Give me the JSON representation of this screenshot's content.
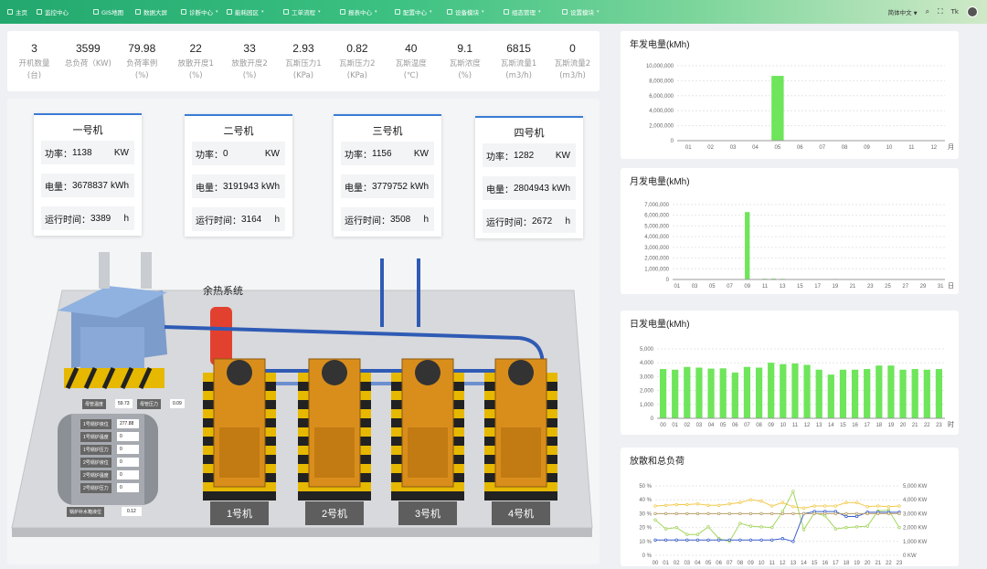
{
  "nav": {
    "items": [
      {
        "label": "主页",
        "icon": "grid-icon"
      },
      {
        "label": "监控中心",
        "icon": "monitor-icon"
      },
      {
        "label": "GIS地图",
        "icon": "map-icon"
      },
      {
        "label": "数据大屏",
        "icon": "screen-icon"
      },
      {
        "label": "诊断中心",
        "icon": "diagnose-icon"
      },
      {
        "label": "能耗园区",
        "icon": "energy-icon"
      },
      {
        "label": "工单流程",
        "icon": "workflow-icon"
      },
      {
        "label": "报表中心",
        "icon": "report-icon"
      },
      {
        "label": "配置中心",
        "icon": "config-icon"
      },
      {
        "label": "设备模块",
        "icon": "device-icon"
      },
      {
        "label": "组态管理",
        "icon": "scada-icon"
      },
      {
        "label": "设置模块",
        "icon": "settings-icon"
      }
    ],
    "language": "简体中文",
    "colors": {
      "start": "#22a86e",
      "end": "#cfe9c7"
    }
  },
  "stats": [
    {
      "value": "3",
      "label": "开机数量",
      "unit": "(台)"
    },
    {
      "value": "3599",
      "label": "总负荷（KW)",
      "unit": ""
    },
    {
      "value": "79.98",
      "label": "负荷率例",
      "unit": "(%)"
    },
    {
      "value": "22",
      "label": "放散开度1",
      "unit": "(%)"
    },
    {
      "value": "33",
      "label": "放散开度2",
      "unit": "(%)"
    },
    {
      "value": "2.93",
      "label": "瓦斯压力1",
      "unit": "(KPa)"
    },
    {
      "value": "0.82",
      "label": "瓦斯压力2",
      "unit": "(KPa)"
    },
    {
      "value": "40",
      "label": "瓦斯温度",
      "unit": "(℃)"
    },
    {
      "value": "9.1",
      "label": "瓦斯浓度",
      "unit": "(%)"
    },
    {
      "value": "6815",
      "label": "瓦斯流量1",
      "unit": "(m3/h)"
    },
    {
      "value": "0",
      "label": "瓦斯流量2",
      "unit": "(m3/h)"
    }
  ],
  "machines": [
    {
      "title": "一号机",
      "power_label": "功率：",
      "power": "1138",
      "power_unit": "KW",
      "energy_label": "电量：",
      "energy": "3678837",
      "energy_unit": "kWh",
      "runtime_label": "运行时间：",
      "runtime": "3389",
      "runtime_unit": "h",
      "tag": "1号机"
    },
    {
      "title": "二号机",
      "power_label": "功率：",
      "power": "0",
      "power_unit": "KW",
      "energy_label": "电量：",
      "energy": "3191943",
      "energy_unit": "kWh",
      "runtime_label": "运行时间：",
      "runtime": "3164",
      "runtime_unit": "h",
      "tag": "2号机"
    },
    {
      "title": "三号机",
      "power_label": "功率：",
      "power": "1156",
      "power_unit": "KW",
      "energy_label": "电量：",
      "energy": "3779752",
      "energy_unit": "kWh",
      "runtime_label": "运行时间：",
      "runtime": "3508",
      "runtime_unit": "h",
      "tag": "3号机"
    },
    {
      "title": "四号机",
      "power_label": "功率：",
      "power": "1282",
      "power_unit": "KW",
      "energy_label": "电量：",
      "energy": "2804943",
      "energy_unit": "kWh",
      "runtime_label": "运行时间：",
      "runtime": "2672",
      "runtime_unit": "h",
      "tag": "4号机"
    }
  ],
  "scene": {
    "waste_heat_label": "余热系统",
    "header_temp_label": "母管温度",
    "header_temp": "59.73",
    "header_pressure_label": "母管压力",
    "header_pressure": "0.09",
    "boiler": [
      {
        "label": "1号锅炉液位",
        "value": "277.88"
      },
      {
        "label": "1号锅炉温度",
        "value": "0"
      },
      {
        "label": "1号锅炉压力",
        "value": "0"
      },
      {
        "label": "2号锅炉液位",
        "value": "0"
      },
      {
        "label": "2号锅炉温度",
        "value": "0"
      },
      {
        "label": "2号锅炉压力",
        "value": "0"
      }
    ],
    "makeup_label": "锅炉补水箱液位",
    "makeup_value": "0.12"
  },
  "charts": {
    "annual": {
      "title": "年发电量(kMh)",
      "xunit": "月"
    },
    "monthly": {
      "title": "月发电量(kMh)",
      "xunit": "日"
    },
    "daily": {
      "title": "日发电量(kMh)",
      "xunit": "时"
    },
    "load": {
      "title": "放散和总负荷"
    }
  },
  "chart_data": [
    {
      "type": "bar",
      "title": "年发电量(kMh)",
      "categories": [
        "01",
        "02",
        "03",
        "04",
        "05",
        "06",
        "07",
        "08",
        "09",
        "10",
        "11",
        "12"
      ],
      "values": [
        0,
        0,
        0,
        0,
        8650000,
        0,
        0,
        0,
        0,
        0,
        0,
        0
      ],
      "yticks": [
        "0",
        "2,000,000",
        "4,000,000",
        "6,000,000",
        "8,000,000",
        "10,000,000"
      ],
      "ylim": [
        0,
        10000000
      ],
      "xlabel": "月",
      "color": "#6ee55a"
    },
    {
      "type": "bar",
      "title": "月发电量(kMh)",
      "categories": [
        "01",
        "02",
        "03",
        "04",
        "05",
        "06",
        "07",
        "08",
        "09",
        "10",
        "11",
        "12",
        "13",
        "14",
        "15",
        "16",
        "17",
        "18",
        "19",
        "20",
        "21",
        "22",
        "23",
        "24",
        "25",
        "26",
        "27",
        "28",
        "29",
        "30",
        "31"
      ],
      "values": [
        0,
        0,
        0,
        0,
        0,
        0,
        0,
        0,
        6300000,
        40000,
        70000,
        80000,
        60000,
        20000,
        0,
        0,
        0,
        30000,
        50000,
        0,
        0,
        0,
        0,
        0,
        0,
        0,
        0,
        0,
        0,
        0,
        0
      ],
      "xticks": [
        "01",
        "03",
        "05",
        "07",
        "09",
        "11",
        "13",
        "15",
        "17",
        "19",
        "21",
        "23",
        "25",
        "27",
        "29",
        "31"
      ],
      "yticks": [
        "0",
        "1,000,000",
        "2,000,000",
        "3,000,000",
        "4,000,000",
        "5,000,000",
        "6,000,000",
        "7,000,000"
      ],
      "ylim": [
        0,
        7000000
      ],
      "xlabel": "日",
      "color": "#6ee55a"
    },
    {
      "type": "bar",
      "title": "日发电量(kMh)",
      "categories": [
        "00",
        "01",
        "02",
        "03",
        "04",
        "05",
        "06",
        "07",
        "08",
        "09",
        "10",
        "11",
        "12",
        "13",
        "14",
        "15",
        "16",
        "17",
        "18",
        "19",
        "20",
        "21",
        "22",
        "23"
      ],
      "values": [
        3550,
        3500,
        3700,
        3650,
        3580,
        3600,
        3300,
        3700,
        3650,
        4000,
        3900,
        3950,
        3850,
        3500,
        3150,
        3500,
        3500,
        3550,
        3800,
        3800,
        3500,
        3550,
        3500,
        3550,
        2150
      ],
      "yticks": [
        "0",
        "1,000",
        "2,000",
        "3,000",
        "4,000",
        "5,000"
      ],
      "ylim": [
        0,
        5000
      ],
      "xlabel": "时",
      "color": "#6ee55a"
    },
    {
      "type": "line",
      "title": "放散和总负荷",
      "categories": [
        "00",
        "01",
        "02",
        "03",
        "04",
        "05",
        "06",
        "07",
        "08",
        "09",
        "10",
        "11",
        "12",
        "13",
        "14",
        "15",
        "16",
        "17",
        "18",
        "19",
        "20",
        "21",
        "22",
        "23"
      ],
      "yticks_left": [
        "0 %",
        "10 %",
        "20 %",
        "30 %",
        "40 %",
        "50 %"
      ],
      "yticks_right": [
        "0 KW",
        "1,000 KW",
        "2,000 KW",
        "3,000 KW",
        "4,000 KW",
        "5,000 KW"
      ],
      "series": [
        {
          "axis": "right",
          "color": "#f2c94c",
          "values": [
            3550,
            3600,
            3650,
            3650,
            3700,
            3600,
            3600,
            3700,
            3800,
            4000,
            3900,
            3550,
            3800,
            3500,
            3400,
            3550,
            3550,
            3550,
            3800,
            3800,
            3500,
            3550,
            3500,
            3550
          ]
        },
        {
          "axis": "right",
          "color": "#a4d65e",
          "values": [
            2550,
            1900,
            2000,
            1500,
            1500,
            2050,
            1200,
            1000,
            2300,
            2100,
            2050,
            2000,
            3150,
            4600,
            1850,
            3050,
            2850,
            1900,
            2000,
            2050,
            2100,
            3200,
            3250,
            2000
          ]
        },
        {
          "axis": "right",
          "color": "#3b5fc9",
          "values": [
            1100,
            1100,
            1100,
            1100,
            1100,
            1100,
            1100,
            1100,
            1100,
            1100,
            1100,
            1100,
            1200,
            1000,
            3000,
            3150,
            3150,
            3150,
            2800,
            2800,
            3100,
            3100,
            3100,
            3100
          ]
        },
        {
          "axis": "left",
          "color": "#b8a06a",
          "values": [
            30,
            30,
            30,
            30,
            30,
            30,
            30,
            30,
            30,
            30,
            30,
            30,
            30,
            30,
            30,
            30,
            30,
            30,
            30,
            30,
            30,
            30,
            30,
            30
          ]
        }
      ]
    }
  ]
}
